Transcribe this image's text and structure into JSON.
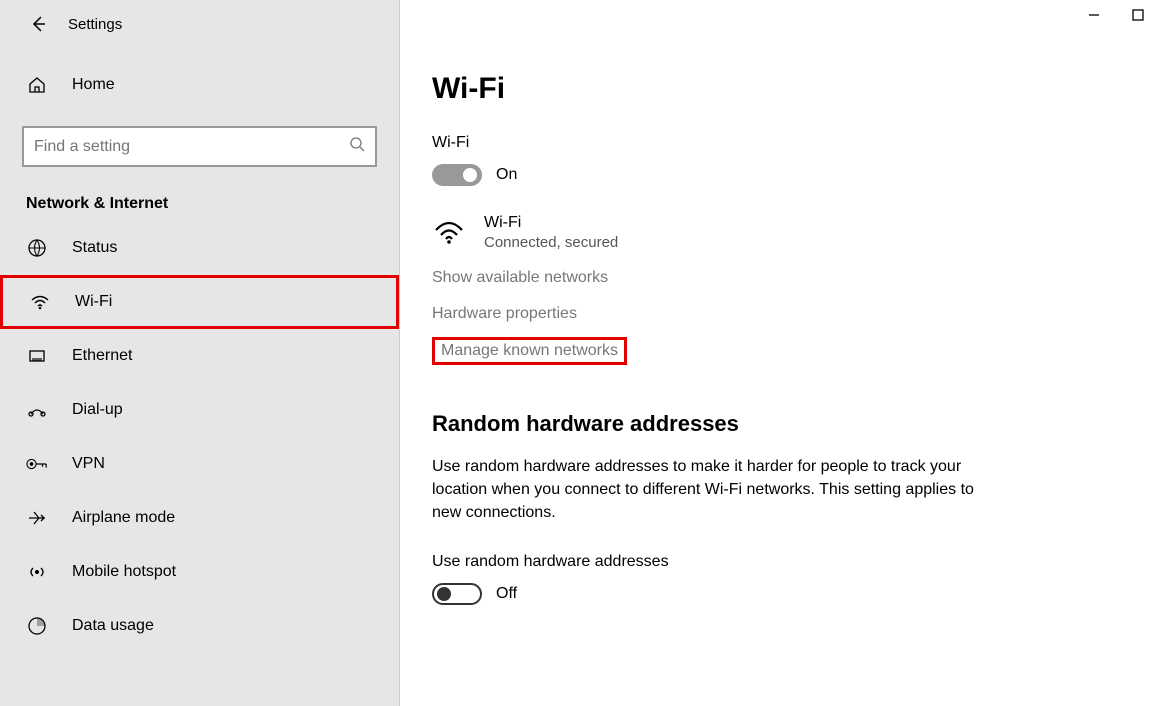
{
  "header": {
    "title": "Settings"
  },
  "sidebar": {
    "home": "Home",
    "search_placeholder": "Find a setting",
    "section": "Network & Internet",
    "items": [
      {
        "label": "Status"
      },
      {
        "label": "Wi-Fi"
      },
      {
        "label": "Ethernet"
      },
      {
        "label": "Dial-up"
      },
      {
        "label": "VPN"
      },
      {
        "label": "Airplane mode"
      },
      {
        "label": "Mobile hotspot"
      },
      {
        "label": "Data usage"
      }
    ]
  },
  "main": {
    "page_title": "Wi-Fi",
    "wifi_label": "Wi-Fi",
    "wifi_toggle_state": "On",
    "wifi_name": "Wi-Fi",
    "wifi_status": "Connected, secured",
    "link_available": "Show available networks",
    "link_hardware": "Hardware properties",
    "link_manage": "Manage known networks",
    "random_title": "Random hardware addresses",
    "random_desc": "Use random hardware addresses to make it harder for people to track your location when you connect to different Wi-Fi networks. This setting applies to new connections.",
    "random_label": "Use random hardware addresses",
    "random_toggle_state": "Off"
  }
}
